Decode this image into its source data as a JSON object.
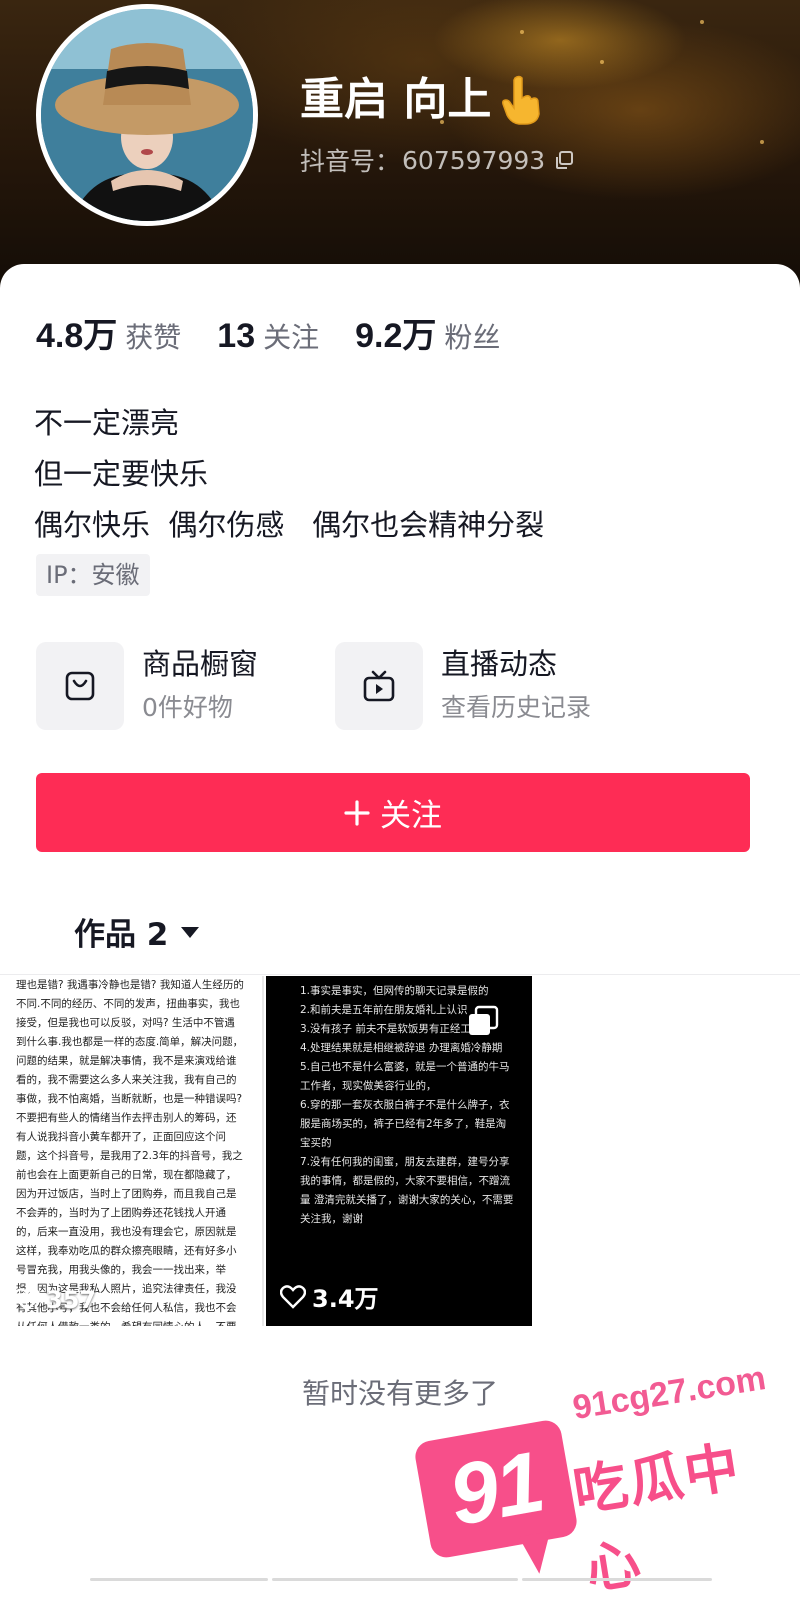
{
  "profile": {
    "name": "重启 向上",
    "account_label": "抖音号：",
    "account_id": "607597993"
  },
  "stats": [
    {
      "value": "4.8万",
      "label": "获赞"
    },
    {
      "value": "13",
      "label": "关注"
    },
    {
      "value": "9.2万",
      "label": "粉丝"
    }
  ],
  "bio": {
    "lines": [
      "不一定漂亮",
      "但一定要快乐",
      "偶尔快乐  偶尔伤感   偶尔也会精神分裂"
    ],
    "ip": "IP：安徽"
  },
  "tools": {
    "shop": {
      "title": "商品橱窗",
      "sub": "0件好物",
      "icon": "shopping-bag-icon"
    },
    "live": {
      "title": "直播动态",
      "sub": "查看历史记录",
      "icon": "tv-icon"
    }
  },
  "follow_button": "关注",
  "works_tab": "作品 2",
  "videos": [
    {
      "likes": "357",
      "text": "理也是错? 我遇事冷静也是错? 我知道人生经历的不同.不同的经历、不同的发声，扭曲事实，我也接受，但是我也可以反驳，对吗? 生活中不管遇到什么事.我也都是一样的态度.简单，解决问题，问题的结果，就是解决事情，我不是来演戏给谁看的，我不需要这么多人来关注我，我有自己的事做，我不怕离婚，当断就断，也是一种错误吗? 不要把有些人的情绪当作去抨击别人的筹码，还有人说我抖音小黄车都开了，正面回应这个问题，这个抖音号，是我用了2.3年的抖音号，我之前也会在上面更新自己的日常，现在都隐藏了，因为开过饭店，当时上了团购券，而且我自己是不会弄的，当时为了上团购券还花钱找人开通的，后来一直没用，我也没有理会它，原因就是这样，我奉劝吃瓜的群众擦亮眼睛，还有好多小号冒充我，用我头像的，我会一一找出来，举报，因为这是我私人照片，追究法律责任，我没有其他小号，我也不会给任何人私信，我也不会从任何人借款一类的，希望有同情心的人，不要被骗，请大家理智吃瓜，不要被网络暴"
    },
    {
      "likes": "3.4万",
      "text": "1.事实是事实，但网传的聊天记录是假的\n2.和前夫是五年前在朋友婚礼上认识\n3.没有孩子 前夫不是软饭男有正经工作\n4.处理结果就是相继被辞退 办理离婚冷静期\n5.自己也不是什么富婆，就是一个普通的牛马工作者，现实做美容行业的，\n6.穿的那一套灰衣服白裤子不是什么牌子，衣服是商场买的，裤子已经有2年多了，鞋是淘宝买的\n7.没有任何我的闺蜜，朋友去建群，建号分享我的事情，都是假的，大家不要相信，不蹭流量 澄清完就关播了，谢谢大家的关心，不需要关注我，谢谢"
    }
  ],
  "footer": "暂时没有更多了",
  "watermark": {
    "number": "91",
    "url": "91cg27.com",
    "text": "吃瓜中心"
  },
  "colors": {
    "accent": "#fe2c55",
    "watermark_pink": "#f74f8a",
    "text_primary": "#161823",
    "text_secondary": "#6b6d78"
  }
}
